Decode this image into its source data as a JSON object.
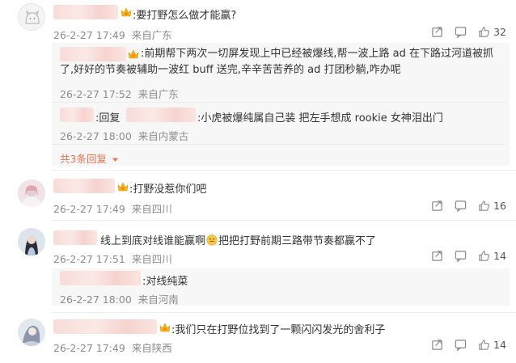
{
  "comments": [
    {
      "text": ":要打野怎么做才能赢?",
      "time": "26-2-27 17:49",
      "location": "来自广东",
      "likes": "32",
      "replies": [
        {
          "text": ":前期帮下两次一切屏发现上中已经被爆线,帮一波上路 ad 在下路过河道被抓了,好好的节奏被辅助一波红 buff 送完,辛辛苦苦养的 ad 打团秒躺,咋办呢",
          "time": "26-2-27 17:52",
          "location": "来自广东"
        },
        {
          "reply_prefix": ":回复",
          "text": ":小虎被爆纯属自己装 把左手想成 rookie 女神泪出门",
          "time": "26-2-27 18:00",
          "location": "来自内蒙古"
        }
      ],
      "more_replies": "共3条回复"
    },
    {
      "text": ":打野没惹你们吧",
      "time": "26-2-27 17:49",
      "location": "来自四川",
      "likes": "16"
    },
    {
      "text_before": "线上到底对线谁能赢啊",
      "text_after": "把把打野前期三路带节奏都赢不了",
      "time": "26-2-27 17:51",
      "location": "来自四川",
      "likes": "14",
      "replies": [
        {
          "text": ":对线纯菜",
          "time": "26-2-27 18:00",
          "location": "来自河南"
        }
      ]
    },
    {
      "text": ":我们只在打野位找到了一颗闪闪发光的舍利子",
      "time": "26-2-27 17:49",
      "location": "来自陕西",
      "likes": "14"
    }
  ],
  "icons": {
    "share": "share-icon",
    "comment": "comment-icon",
    "like": "thumbs-up-icon",
    "crown": "vip-crown-icon",
    "emoji": "emoji-icon",
    "dropdown": "triangle-down-icon"
  },
  "colors": {
    "accent": "#eb7350",
    "meta_text": "#8c8c8c",
    "reply_bg": "#f7f7f7"
  }
}
